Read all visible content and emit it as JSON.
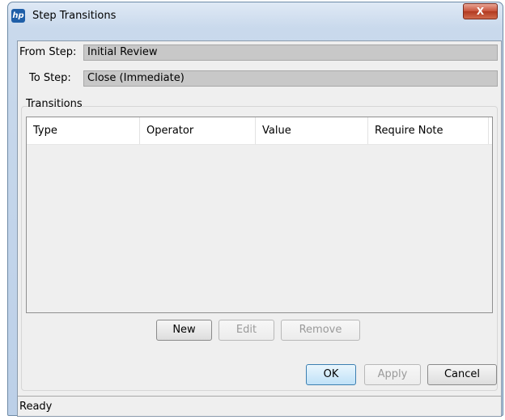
{
  "window": {
    "title": "Step Transitions",
    "close_label": "X"
  },
  "fields": {
    "from_step_label": "From Step:",
    "from_step_value": "Initial Review",
    "to_step_label": "To Step:",
    "to_step_value": "Close (Immediate)"
  },
  "transitions": {
    "group_label": "Transitions",
    "columns": [
      "Type",
      "Operator",
      "Value",
      "Require Note"
    ],
    "rows": []
  },
  "table_buttons": {
    "new": "New",
    "edit": "Edit",
    "remove": "Remove"
  },
  "dialog_buttons": {
    "ok": "OK",
    "apply": "Apply",
    "cancel": "Cancel"
  },
  "status": "Ready",
  "icons": {
    "app": "hp-logo-icon"
  }
}
